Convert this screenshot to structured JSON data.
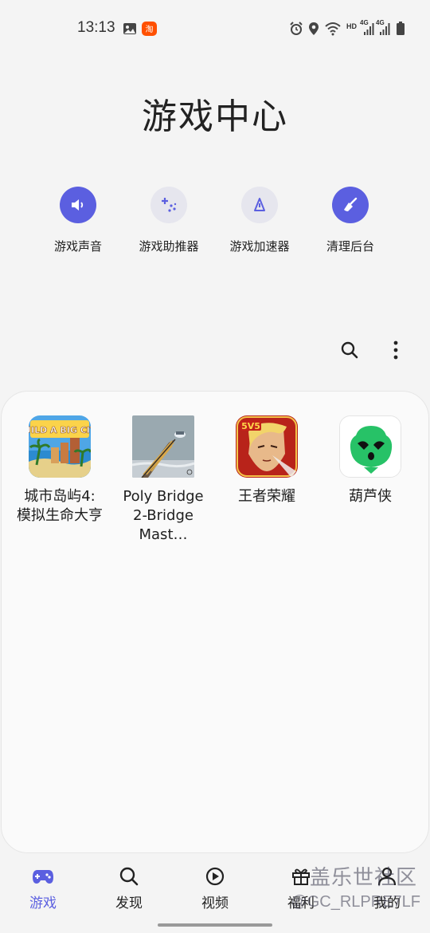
{
  "status_bar": {
    "time": "13:13",
    "network_hd": "HD",
    "network_4g_1": "4G",
    "network_4g_2": "4G",
    "icons": [
      "image-icon",
      "taobao-app-icon",
      "alarm-icon",
      "location-icon",
      "wifi-icon",
      "signal-icon",
      "battery-icon"
    ]
  },
  "page_title": "游戏中心",
  "tools": [
    {
      "label": "游戏声音",
      "icon": "speaker-icon",
      "active": true
    },
    {
      "label": "游戏助推器",
      "icon": "sparkle-icon",
      "active": false
    },
    {
      "label": "游戏加速器",
      "icon": "triangle-icon",
      "active": false
    },
    {
      "label": "清理后台",
      "icon": "broom-icon",
      "active": true
    }
  ],
  "actions": {
    "search": "search-icon",
    "more": "more-vert-icon"
  },
  "games": [
    {
      "label": "城市岛屿4:\n模拟生命大亨",
      "icon": "city-island-icon",
      "icon_text": "BUILD A BIG CITY"
    },
    {
      "label": "Poly Bridge\n2-Bridge Mast…",
      "icon": "poly-bridge-icon"
    },
    {
      "label": "王者荣耀",
      "icon": "honor-of-kings-icon",
      "icon_text": "5V5"
    },
    {
      "label": "葫芦侠",
      "icon": "huluxia-icon"
    }
  ],
  "bottom_nav": [
    {
      "label": "游戏",
      "icon": "gamepad-icon",
      "active": true
    },
    {
      "label": "发现",
      "icon": "search-icon",
      "active": false
    },
    {
      "label": "视频",
      "icon": "play-icon",
      "active": false
    },
    {
      "label": "福利",
      "icon": "gift-icon",
      "active": false
    },
    {
      "label": "我的",
      "icon": "person-icon",
      "active": false
    }
  ],
  "watermark": {
    "line1": "盖乐世社区",
    "line2": "@GC_RLPRE7LF"
  },
  "colors": {
    "accent": "#5b5fe0",
    "background": "#f4f4f4",
    "card": "#fafafa"
  }
}
